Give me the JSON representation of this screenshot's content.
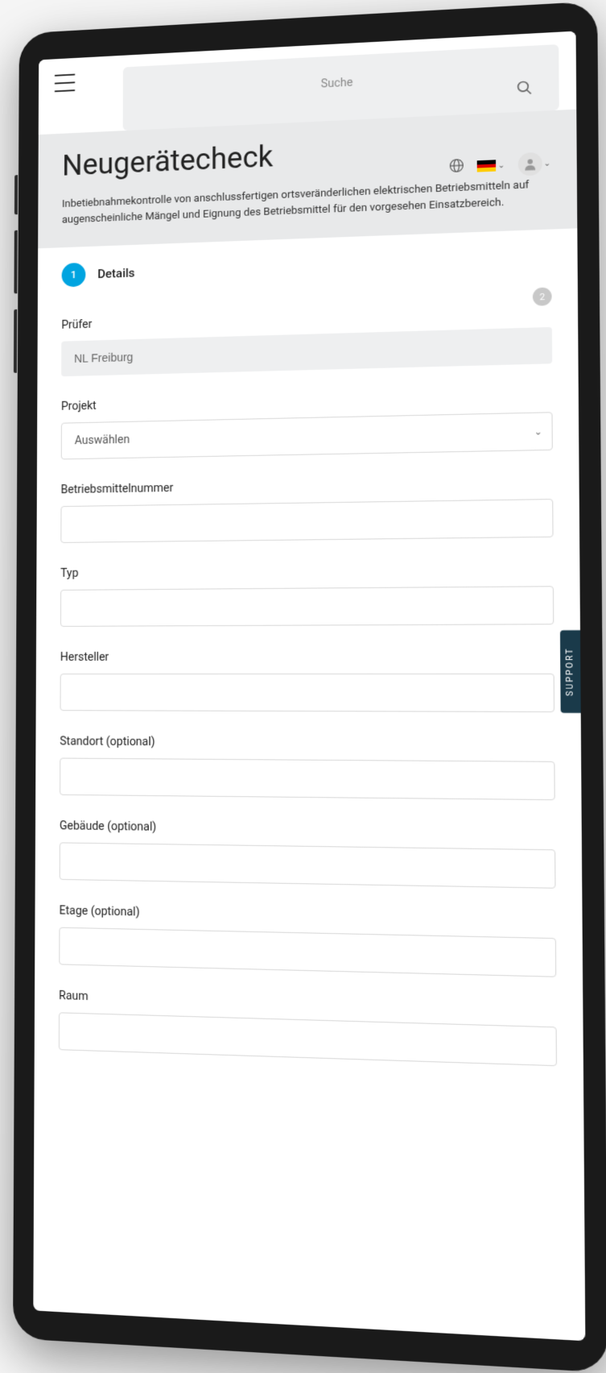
{
  "search": {
    "placeholder": "Suche"
  },
  "header": {
    "language": "DE"
  },
  "page": {
    "title": "Neugerätecheck",
    "subtitle": "Inbetiebnahmekontrolle von anschlussfertigen ortsveränderlichen elektrischen Betriebsmitteln auf augenscheinliche Mängel und Eignung des Betriebsmittel für den vorgesehen Einsatzbereich."
  },
  "step": {
    "current_number": "1",
    "current_title": "Details",
    "next_number": "2"
  },
  "form": {
    "pruefer": {
      "label": "Prüfer",
      "value": "NL Freiburg"
    },
    "projekt": {
      "label": "Projekt",
      "placeholder": "Auswählen"
    },
    "betriebsmittelnummer": {
      "label": "Betriebsmittelnummer",
      "value": ""
    },
    "typ": {
      "label": "Typ",
      "value": ""
    },
    "hersteller": {
      "label": "Hersteller",
      "value": ""
    },
    "standort": {
      "label": "Standort (optional)",
      "value": ""
    },
    "gebaeude": {
      "label": "Gebäude (optional)",
      "value": ""
    },
    "etage": {
      "label": "Etage (optional)",
      "value": ""
    },
    "raum": {
      "label": "Raum",
      "value": ""
    }
  },
  "support": {
    "label": "SUPPORT"
  }
}
